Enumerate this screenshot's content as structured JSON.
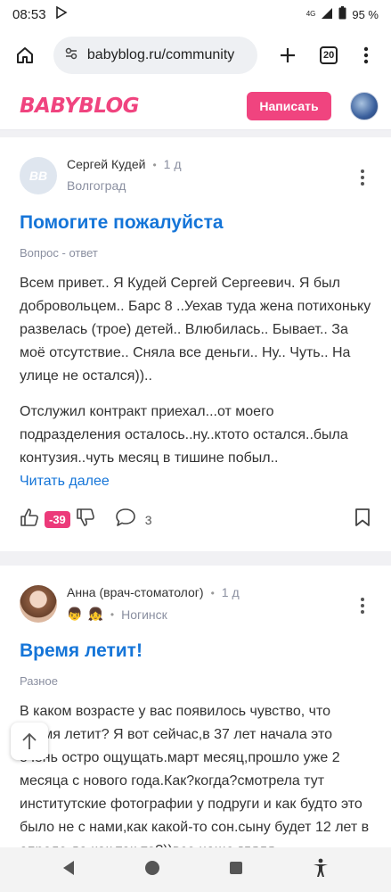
{
  "status_bar": {
    "time": "08:53",
    "network": "4G",
    "battery": "95 %"
  },
  "browser": {
    "url": "babyblog.ru/community",
    "tabs_count": "20"
  },
  "site_header": {
    "logo": "BABYBLOG",
    "write_button": "Написать"
  },
  "posts": [
    {
      "avatar_initials": "BB",
      "author": "Сергей Кудей",
      "time_ago": "1 д",
      "location": "Волгоград",
      "title": "Помогите пожалуйста",
      "category": "Вопрос - ответ",
      "paragraphs": [
        "Всем привет.. Я Кудей Сергей Сергеевич. Я был добровольцем.. Барс 8 ..Уехав туда жена потихоньку развелась (трое) детей.. Влюбилась.. Бывает.. За моё отсутствие.. Сняла все деньги.. Ну.. Чуть.. На улице не остался))..",
        "Отслужил контракт приехал...от моего подразделения осталось..ну..ктото остался..была контузия..чуть месяц в тишине побыл.."
      ],
      "read_more": "Читать далее",
      "score": "-39",
      "comments": "3"
    },
    {
      "author": "Анна (врач-стоматолог)",
      "time_ago": "1 д",
      "badges": [
        "👦",
        "👧"
      ],
      "location": "Ногинск",
      "title": "Время летит!",
      "category": "Разное",
      "paragraphs": [
        "В каком возрасте у вас появилось чувство, что время летит? Я вот сейчас,в 37 лет начала это очень остро ощущать.март месяц,прошло уже 2 месяца с нового года.Как?когда?смотрела тут институтские фотографии у подруги и как будто это было не с нами,как какой-то сон.сыну будет 12 лет в апреле,да как так-то?))все чаще гляля"
      ]
    }
  ],
  "colors": {
    "brand_pink": "#f0447f",
    "score_pink": "#ec3a7a",
    "link_blue": "#1575d8"
  },
  "icons": {
    "like": "thumb-up-icon",
    "dislike": "thumb-down-icon",
    "comment": "speech-bubble-icon",
    "bookmark": "bookmark-icon"
  }
}
